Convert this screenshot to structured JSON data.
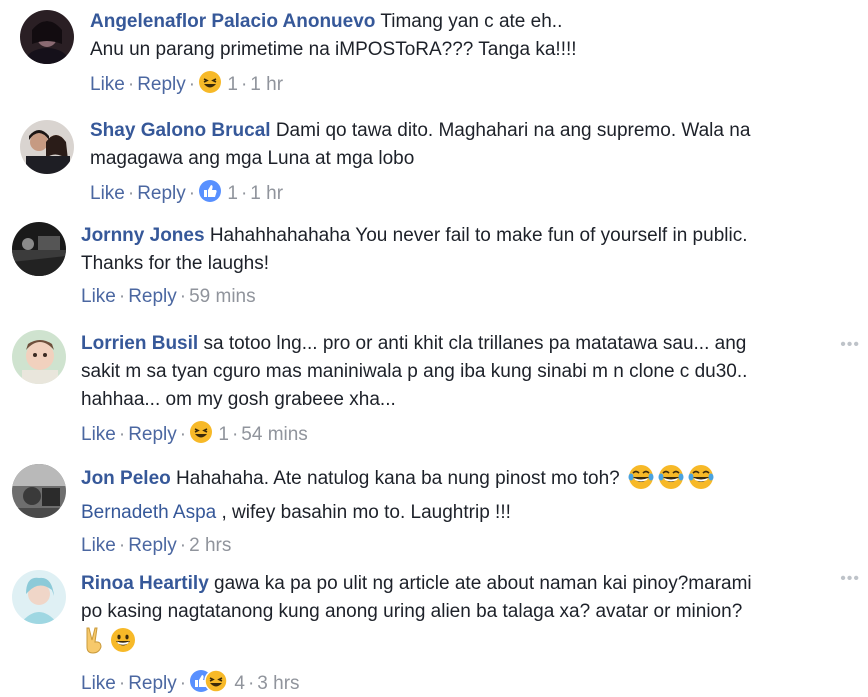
{
  "comments": [
    {
      "author": "Angelenaflor Palacio Anonuevo",
      "lines": [
        "Timang yan c ate eh..",
        "Anu un parang primetime na iMPOSToRA??? Tanga ka!!!!"
      ],
      "like": "Like",
      "reply": "Reply",
      "reaction_icon": "laughing-emoji-icon",
      "reaction_count": "1",
      "time": "1 hr"
    },
    {
      "author": "Shay Galono Brucal",
      "lines": [
        "Dami qo tawa dito. Maghahari na ang supremo. Wala na",
        "magagawa ang mga Luna at mga lobo"
      ],
      "like": "Like",
      "reply": "Reply",
      "reaction_icon": "thumbs-up-icon",
      "reaction_count": "1",
      "time": "1 hr"
    },
    {
      "author": "Jornny Jones",
      "lines": [
        "Hahahhahahaha You never fail to make fun of yourself in public.",
        "Thanks for the laughs!"
      ],
      "like": "Like",
      "reply": "Reply",
      "time": "59 mins"
    },
    {
      "author": "Lorrien Busil",
      "lines": [
        "sa totoo lng... pro or anti khit cla trillanes pa matatawa sau... ang",
        "sakit m sa tyan cguro mas maniniwala p ang iba kung sinabi m n clone c du30..",
        "hahhaa... om my gosh grabeee xha..."
      ],
      "like": "Like",
      "reply": "Reply",
      "reaction_icon": "laughing-emoji-icon",
      "reaction_count": "1",
      "time": "54 mins"
    },
    {
      "author": "Jon Peleo",
      "lines": [
        "Hahahaha. Ate natulog kana ba nung pinost mo toh?"
      ],
      "mention": "Bernadeth Aspa",
      "mention_rest": ", wifey basahin mo to. Laughtrip !!!",
      "like": "Like",
      "reply": "Reply",
      "time": "2 hrs"
    },
    {
      "author": "Rinoa Heartily",
      "lines": [
        "gawa ka pa po ulit ng article ate about naman kai pinoy?marami",
        "po kasing nagtatanong kung anong uring alien ba talaga xa? avatar or minion?"
      ],
      "like": "Like",
      "reply": "Reply",
      "reaction_icon": "thumbs-up-and-laughing-icons",
      "reaction_count": "4",
      "time": "3 hrs"
    }
  ],
  "colors": {
    "author": "#365899",
    "link": "#4b67a1",
    "meta": "#90949c",
    "text": "#1d2129"
  },
  "dots_label": "•••",
  "dot_sep": "·"
}
